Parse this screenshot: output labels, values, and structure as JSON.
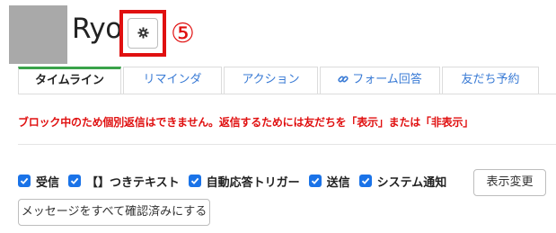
{
  "header": {
    "user_name": "Ryo",
    "annotation_number": "⑤",
    "settings_icon": "gear-icon"
  },
  "colors": {
    "annotation": "#e01010",
    "active_tab_border": "#3aa34a",
    "tab_link": "#3a7bd5",
    "warning": "#e01010",
    "checkbox": "#1a73e8"
  },
  "tabs": [
    {
      "label": "タイムライン",
      "active": true
    },
    {
      "label": "リマインダ",
      "active": false
    },
    {
      "label": "アクション",
      "active": false
    },
    {
      "label": "フォーム回答",
      "active": false,
      "icon": "link-icon"
    },
    {
      "label": "友だち予約",
      "active": false
    }
  ],
  "warning_text": "ブロック中のため個別返信はできません。返信するためには友だちを「表示」または「非表示」",
  "filters": [
    {
      "label": "受信",
      "checked": true
    },
    {
      "label": "【】つきテキスト",
      "checked": true
    },
    {
      "label": "自動応答トリガー",
      "checked": true
    },
    {
      "label": "送信",
      "checked": true
    },
    {
      "label": "システム通知",
      "checked": true
    }
  ],
  "buttons": {
    "display_change": "表示変更",
    "mark_all_read": "メッセージをすべて確認済みにする"
  }
}
